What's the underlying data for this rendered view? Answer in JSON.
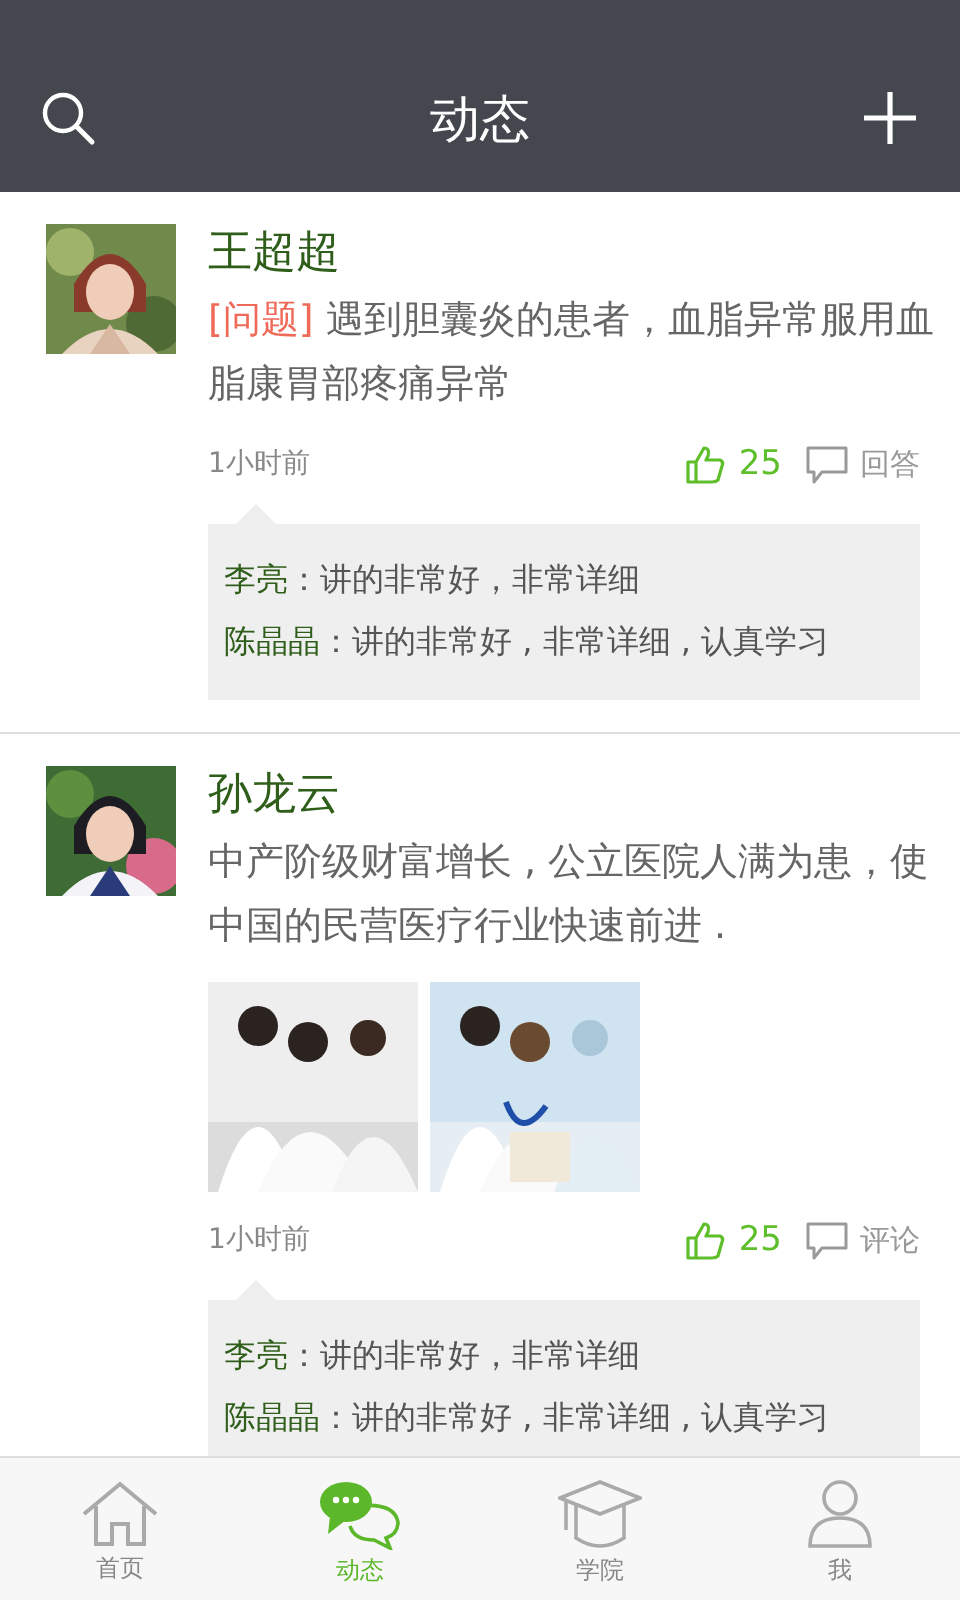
{
  "header": {
    "title": "动态"
  },
  "posts": [
    {
      "author": "王超超",
      "tag": "[问题]",
      "text": "遇到胆囊炎的患者，血脂异常服用血脂康胃部疼痛异常",
      "time": "1小时前",
      "likes": "25",
      "action": "回答",
      "comments": [
        {
          "author": "李亮",
          "text": "：讲的非常好，非常详细"
        },
        {
          "author": "陈晶晶",
          "text": "：讲的非常好 , 非常详细 , 认真学习"
        }
      ]
    },
    {
      "author": "孙龙云",
      "text": "中产阶级财富增长 , 公立医院人满为患，使中国的民营医疗行业快速前进 .",
      "time": "1小时前",
      "likes": "25",
      "action": "评论",
      "comments": [
        {
          "author": "李亮",
          "text": "：讲的非常好，非常详细"
        },
        {
          "author": "陈晶晶",
          "text": "：讲的非常好 , 非常详细 , 认真学习"
        }
      ]
    }
  ],
  "tabs": [
    {
      "label": "首页",
      "selected": false
    },
    {
      "label": "动态",
      "selected": true
    },
    {
      "label": "学院",
      "selected": false
    },
    {
      "label": "我",
      "selected": false
    }
  ]
}
